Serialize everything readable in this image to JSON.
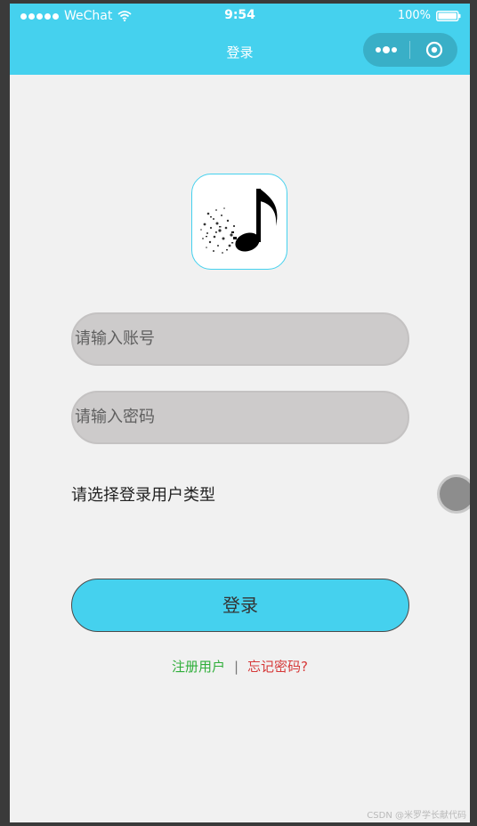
{
  "status_bar": {
    "carrier": "WeChat",
    "time": "9:54",
    "battery_percent": "100%",
    "battery_level": 1.0,
    "signal_icon": "signal-dots-icon",
    "wifi_icon": "wifi-icon",
    "battery_icon": "battery-icon"
  },
  "nav": {
    "title": "登录",
    "more_icon": "more-dots-icon",
    "close_icon": "target-icon"
  },
  "logo": {
    "icon": "music-note-logo-icon"
  },
  "form": {
    "account_placeholder": "请输入账号",
    "password_placeholder": "请输入密码",
    "user_type_label": "请选择登录用户类型"
  },
  "actions": {
    "login_label": "登录",
    "register_label": "注册用户",
    "separator": "|",
    "forgot_label": "忘记密码?"
  },
  "watermark": "CSDN @米罗学长献代码",
  "colors": {
    "accent": "#45d1ee",
    "background": "#f1f1f1",
    "input_bg": "#cdcbcb",
    "register_link": "#2fae3a",
    "forgot_link": "#d63a3a"
  }
}
